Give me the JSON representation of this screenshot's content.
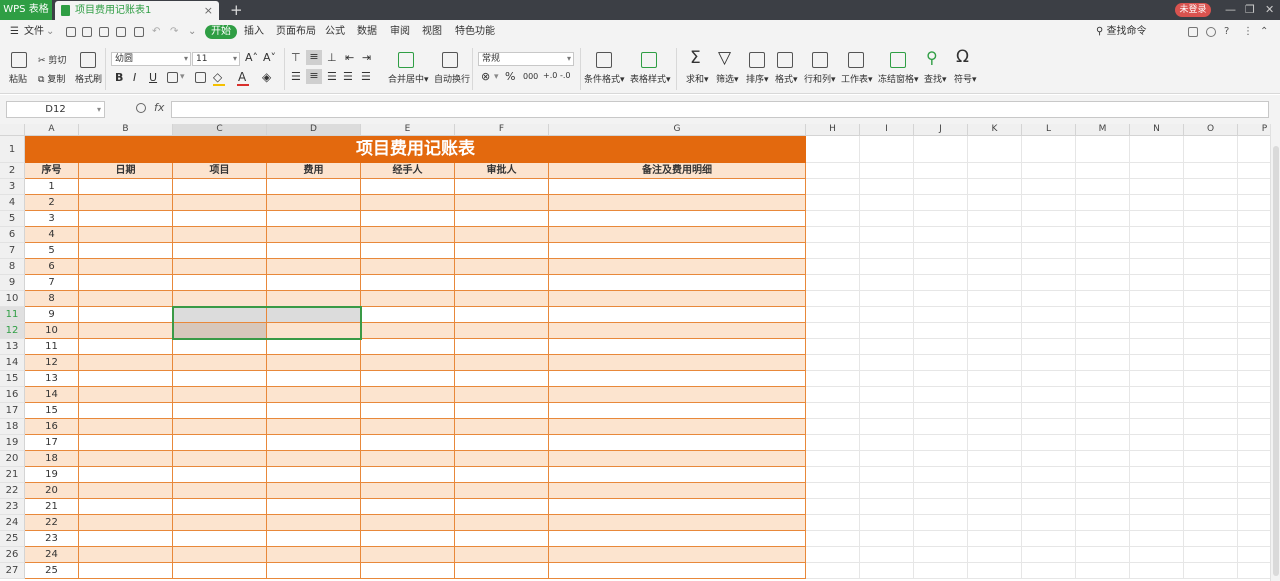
{
  "titlebar": {
    "app_name": "WPS 表格",
    "doc_tab": "项目费用记账表1",
    "new_tab": "+",
    "login": "未登录",
    "close_tab": "×"
  },
  "menu": {
    "file": "文件",
    "tabs": [
      "开始",
      "插入",
      "页面布局",
      "公式",
      "数据",
      "审阅",
      "视图",
      "特色功能"
    ],
    "active_tab": "开始",
    "search": "查找命令"
  },
  "ribbon": {
    "paste": "粘贴",
    "cut": "剪切",
    "copy": "复制",
    "format_painter": "格式刷",
    "font_name": "幼圆",
    "font_size": "11",
    "bold": "B",
    "italic": "I",
    "underline": "U",
    "merge_center": "合并居中",
    "wrap_text": "自动换行",
    "number_format": "常规",
    "percent": "%",
    "thousands": "000",
    "cond_format": "条件格式",
    "table_style": "表格样式",
    "sum": "求和",
    "filter": "筛选",
    "sort": "排序",
    "format": "格式",
    "row_col": "行和列",
    "worksheet": "工作表",
    "freeze": "冻结窗格",
    "find": "查找",
    "symbol": "符号"
  },
  "formula_bar": {
    "cell_ref": "D12",
    "fx": "fx",
    "value": ""
  },
  "sheet": {
    "columns": [
      "A",
      "B",
      "C",
      "D",
      "E",
      "F",
      "G",
      "H",
      "I",
      "J",
      "K",
      "L",
      "M",
      "N",
      "O",
      "P"
    ],
    "title": "项目费用记账表",
    "headers": [
      "序号",
      "日期",
      "项目",
      "费用",
      "经手人",
      "审批人",
      "备注及费用明细"
    ],
    "row_numbers": [
      "1",
      "2",
      "3",
      "4",
      "5",
      "6",
      "7",
      "8",
      "9",
      "10",
      "11",
      "12",
      "13",
      "14",
      "15",
      "16",
      "17",
      "18",
      "19",
      "20",
      "21",
      "22",
      "23",
      "24",
      "25",
      "26",
      "27"
    ],
    "serials": [
      "1",
      "2",
      "3",
      "4",
      "5",
      "6",
      "7",
      "8",
      "9",
      "10",
      "11",
      "12",
      "13",
      "14",
      "15",
      "16",
      "17",
      "18",
      "19",
      "20",
      "21",
      "22",
      "23",
      "24",
      "25"
    ],
    "selected_range": "C11:D12"
  }
}
